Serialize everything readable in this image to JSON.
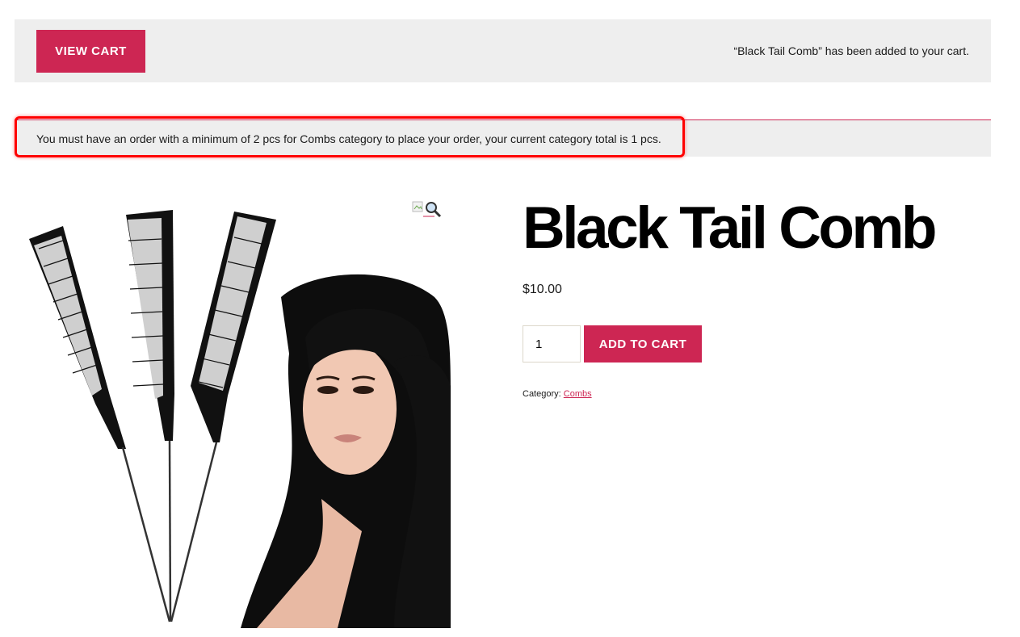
{
  "notice": {
    "view_cart_label": "View cart",
    "message": "“Black Tail Comb” has been added to your cart."
  },
  "error": {
    "message": "You must have an order with a minimum of 2 pcs for Combs category to place your order, your current category total is 1 pcs."
  },
  "gallery": {
    "zoom_icon": "magnifier-icon",
    "image_alt": "Black tail combs and woman with long straight black hair"
  },
  "product": {
    "title": "Black Tail Comb",
    "price": "$10.00",
    "quantity": "1",
    "add_to_cart_label": "Add to cart",
    "category_label": "Category:",
    "category_link": "Combs"
  },
  "colors": {
    "accent": "#cd2653",
    "notice_bg": "#eeeeee",
    "highlight": "#ff0000"
  }
}
